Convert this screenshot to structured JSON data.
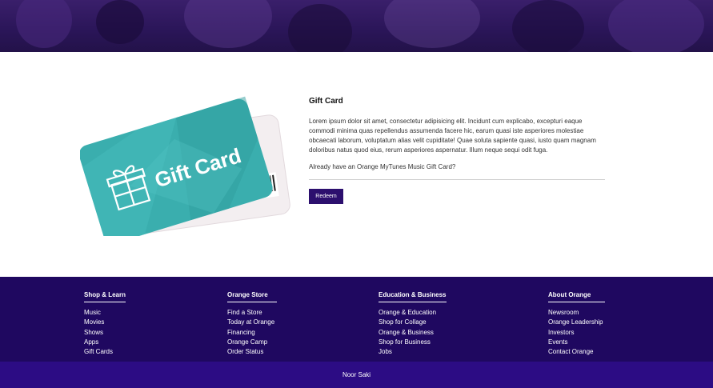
{
  "colors": {
    "hero": "#2a1558",
    "footer": "#1f0860",
    "bottom_bar": "#2c0c84",
    "button": "#2c0f6e",
    "card_teal": "#3aaeae"
  },
  "card": {
    "label": "Gift Card",
    "icon": "gift-icon"
  },
  "info": {
    "title": "Gift Card",
    "body": "Lorem ipsum dolor sit amet, consectetur adipisicing elit. Incidunt cum explicabo, excepturi eaque commodi minima quas repellendus assumenda facere hic, earum quasi iste asperiores molestiae obcaecati laborum, voluptatum alias velit cupiditate! Quae soluta sapiente quasi, iusto quam magnam doloribus natus quod eius, rerum asperiores aspernatur. Illum neque sequi odit fuga.",
    "question": "Already have an Orange MyTunes Music Gift Card?",
    "redeem_label": "Redeem"
  },
  "footer": {
    "columns": [
      {
        "title": "Shop & Learn",
        "items": [
          "Music",
          "Movies",
          "Shows",
          "Apps",
          "Gift Cards"
        ]
      },
      {
        "title": "Orange Store",
        "items": [
          "Find a Store",
          "Today at Orange",
          "Financing",
          "Orange Camp",
          "Order Status"
        ]
      },
      {
        "title": "Education & Business",
        "items": [
          "Orange & Education",
          "Shop for Collage",
          "Orange & Business",
          "Shop for Business",
          "Jobs"
        ]
      },
      {
        "title": "About Orange",
        "items": [
          "Newsroom",
          "Orange Leadership",
          "Investors",
          "Events",
          "Contact Orange"
        ]
      }
    ]
  },
  "bottom_bar": {
    "text": "Noor Saki"
  }
}
